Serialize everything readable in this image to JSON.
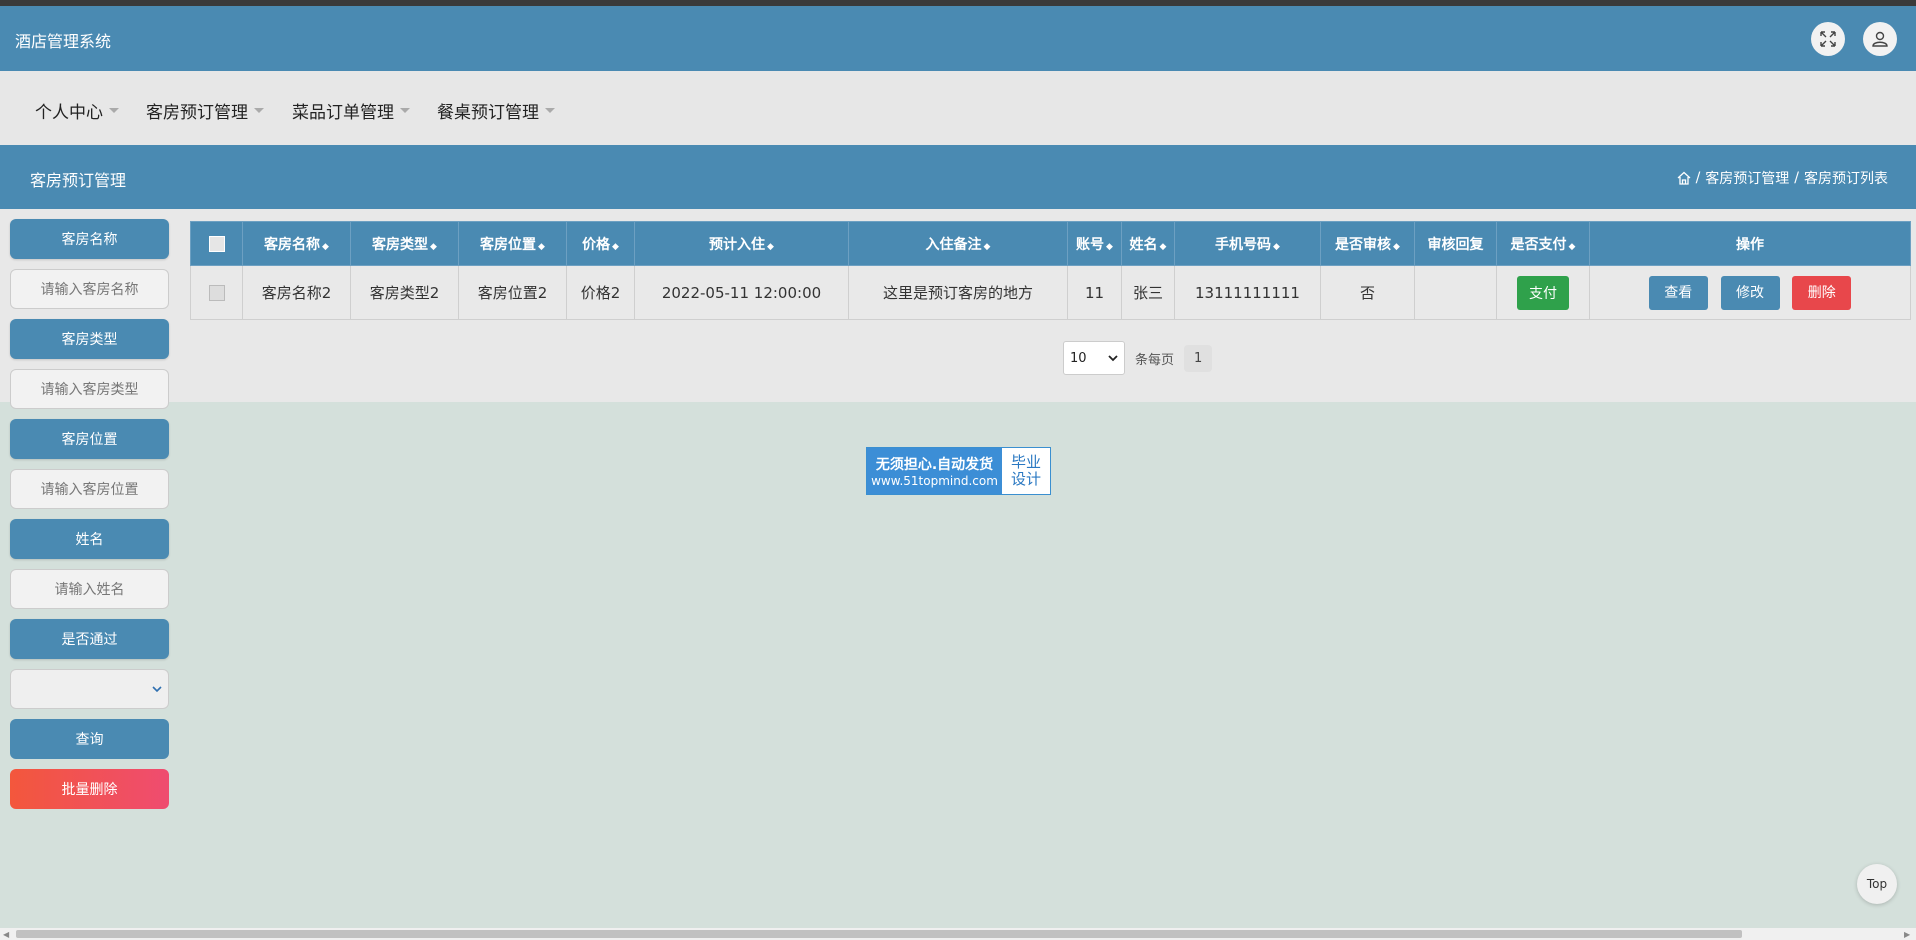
{
  "header": {
    "app_title": "酒店管理系统"
  },
  "nav": {
    "items": [
      {
        "label": "个人中心"
      },
      {
        "label": "客房预订管理"
      },
      {
        "label": "菜品订单管理"
      },
      {
        "label": "餐桌预订管理"
      }
    ]
  },
  "titlebar": {
    "page_title": "客房预订管理",
    "breadcrumb": [
      "/",
      "客房预订管理",
      "/",
      "客房预订列表"
    ]
  },
  "sidebar": {
    "room_name_label": "客房名称",
    "room_name_placeholder": "请输入客房名称",
    "room_type_label": "客房类型",
    "room_type_placeholder": "请输入客房类型",
    "room_location_label": "客房位置",
    "room_location_placeholder": "请输入客房位置",
    "name_label": "姓名",
    "name_placeholder": "请输入姓名",
    "approved_label": "是否通过",
    "query_button": "查询",
    "batch_delete_button": "批量删除"
  },
  "table": {
    "columns": [
      "客房名称",
      "客房类型",
      "客房位置",
      "价格",
      "预计入住",
      "入住备注",
      "账号",
      "姓名",
      "手机号码",
      "是否审核",
      "审核回复",
      "是否支付",
      "操作"
    ],
    "rows": [
      {
        "room_name": "客房名称2",
        "room_type": "客房类型2",
        "room_location": "客房位置2",
        "price": "价格2",
        "checkin": "2022-05-11 12:00:00",
        "remark": "这里是预订客房的地方",
        "account": "11",
        "name": "张三",
        "phone": "13111111111",
        "reviewed": "否",
        "reply": "",
        "pay_button": "支付",
        "view_button": "查看",
        "edit_button": "修改",
        "delete_button": "删除"
      }
    ]
  },
  "pager": {
    "page_size": "10",
    "per_page_label": "条每页",
    "current_page": "1"
  },
  "watermark": {
    "line1": "无须担心.自动发货",
    "line2": "www.51topmind.com",
    "right1": "毕业",
    "right2": "设计"
  },
  "top_button": "Top",
  "colors": {
    "primary": "#4a8ab2",
    "pay": "#2fa14b",
    "danger": "#e8474b"
  }
}
